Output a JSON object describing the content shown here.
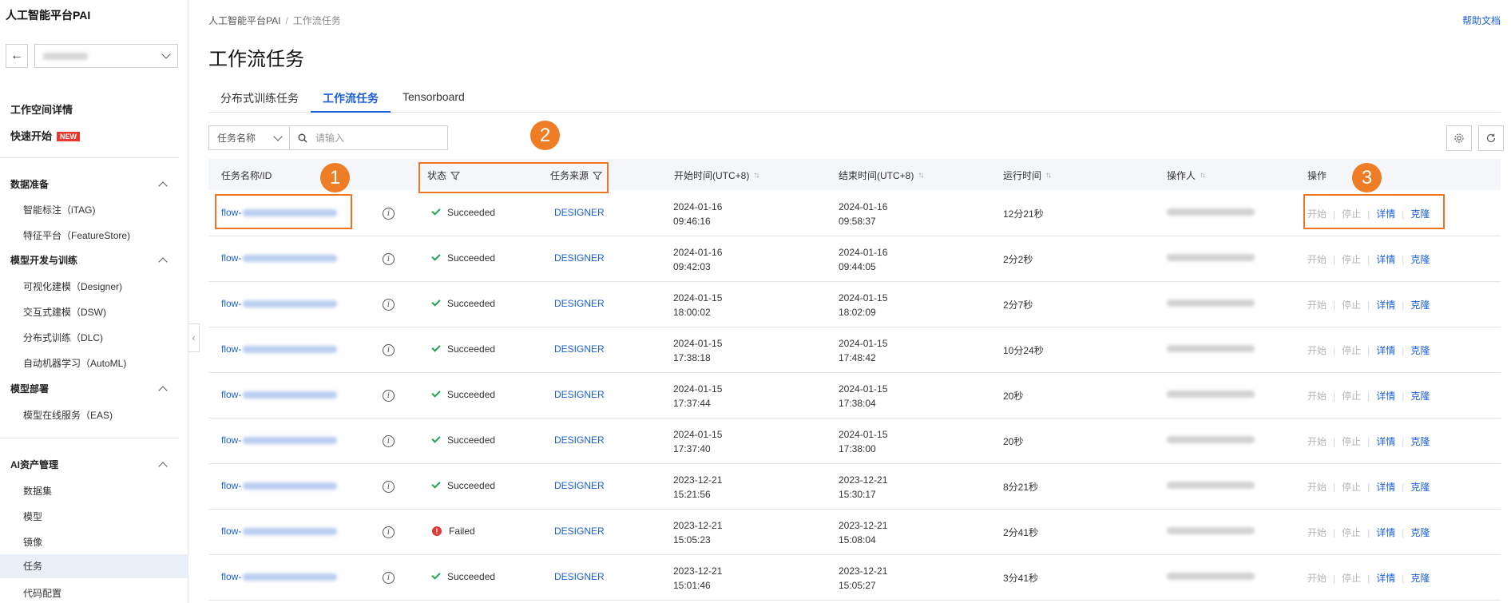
{
  "sidebar": {
    "app_title": "人工智能平台PAI",
    "workspace_name": "",
    "workspace_detail": "工作空间详情",
    "quick_start": "快速开始",
    "quick_start_badge": "NEW",
    "groups": [
      {
        "label": "数据准备",
        "items": [
          "智能标注（iTAG)",
          "特征平台（FeatureStore)"
        ]
      },
      {
        "label": "模型开发与训练",
        "items": [
          "可视化建模（Designer)",
          "交互式建模（DSW)",
          "分布式训练（DLC)",
          "自动机器学习（AutoML)"
        ]
      },
      {
        "label": "模型部署",
        "items": [
          "模型在线服务（EAS)"
        ]
      },
      {
        "label": "AI资产管理",
        "items": [
          "数据集",
          "模型",
          "镜像",
          "任务",
          "代码配置"
        ]
      }
    ],
    "active_item": "任务"
  },
  "header": {
    "breadcrumb": [
      "人工智能平台PAI",
      "工作流任务"
    ],
    "help_link": "帮助文档",
    "page_title": "工作流任务"
  },
  "tabs": [
    {
      "label": "分布式训练任务",
      "active": false
    },
    {
      "label": "工作流任务",
      "active": true
    },
    {
      "label": "Tensorboard",
      "active": false
    }
  ],
  "toolbar": {
    "field_select": "任务名称",
    "search_placeholder": "请输入"
  },
  "table": {
    "columns": {
      "name": "任务名称/ID",
      "status": "状态",
      "source": "任务来源",
      "start": "开始时间(UTC+8)",
      "end": "结束时间(UTC+8)",
      "duration": "运行时间",
      "operator": "操作人",
      "actions": "操作"
    },
    "actions": {
      "start": "开始",
      "stop": "停止",
      "detail": "详情",
      "clone": "克隆"
    },
    "rows": [
      {
        "id_prefix": "flow-",
        "status": "Succeeded",
        "status_type": "success",
        "source": "DESIGNER",
        "start_date": "2024-01-16",
        "start_time": "09:46:16",
        "end_date": "2024-01-16",
        "end_time": "09:58:37",
        "duration": "12分21秒"
      },
      {
        "id_prefix": "flow-",
        "status": "Succeeded",
        "status_type": "success",
        "source": "DESIGNER",
        "start_date": "2024-01-16",
        "start_time": "09:42:03",
        "end_date": "2024-01-16",
        "end_time": "09:44:05",
        "duration": "2分2秒"
      },
      {
        "id_prefix": "flow-",
        "status": "Succeeded",
        "status_type": "success",
        "source": "DESIGNER",
        "start_date": "2024-01-15",
        "start_time": "18:00:02",
        "end_date": "2024-01-15",
        "end_time": "18:02:09",
        "duration": "2分7秒"
      },
      {
        "id_prefix": "flow-",
        "status": "Succeeded",
        "status_type": "success",
        "source": "DESIGNER",
        "start_date": "2024-01-15",
        "start_time": "17:38:18",
        "end_date": "2024-01-15",
        "end_time": "17:48:42",
        "duration": "10分24秒"
      },
      {
        "id_prefix": "flow-",
        "status": "Succeeded",
        "status_type": "success",
        "source": "DESIGNER",
        "start_date": "2024-01-15",
        "start_time": "17:37:44",
        "end_date": "2024-01-15",
        "end_time": "17:38:04",
        "duration": "20秒"
      },
      {
        "id_prefix": "flow-",
        "status": "Succeeded",
        "status_type": "success",
        "source": "DESIGNER",
        "start_date": "2024-01-15",
        "start_time": "17:37:40",
        "end_date": "2024-01-15",
        "end_time": "17:38:00",
        "duration": "20秒"
      },
      {
        "id_prefix": "flow-",
        "status": "Succeeded",
        "status_type": "success",
        "source": "DESIGNER",
        "start_date": "2023-12-21",
        "start_time": "15:21:56",
        "end_date": "2023-12-21",
        "end_time": "15:30:17",
        "duration": "8分21秒"
      },
      {
        "id_prefix": "flow-",
        "status": "Failed",
        "status_type": "failed",
        "source": "DESIGNER",
        "start_date": "2023-12-21",
        "start_time": "15:05:23",
        "end_date": "2023-12-21",
        "end_time": "15:08:04",
        "duration": "2分41秒"
      },
      {
        "id_prefix": "flow-",
        "status": "Succeeded",
        "status_type": "success",
        "source": "DESIGNER",
        "start_date": "2023-12-21",
        "start_time": "15:01:46",
        "end_date": "2023-12-21",
        "end_time": "15:05:27",
        "duration": "3分41秒"
      }
    ]
  },
  "annotations": [
    "1",
    "2",
    "3"
  ],
  "colors": {
    "accent": "#1a5fd6",
    "annotation": "#ee7522",
    "success": "#23a455",
    "failed": "#e03a3a"
  }
}
